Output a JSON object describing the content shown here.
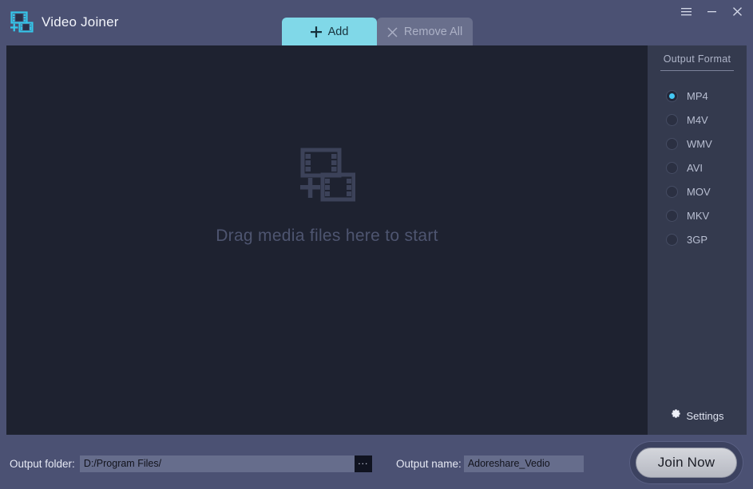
{
  "app": {
    "title": "Video Joiner",
    "logo_icon": "film-plus-icon"
  },
  "window_controls": {
    "menu_icon": "hamburger-menu-icon",
    "minimize_icon": "minimize-icon",
    "close_icon": "close-icon"
  },
  "tabs": [
    {
      "id": "add",
      "label": "Add",
      "icon": "plus-icon",
      "state": "active"
    },
    {
      "id": "remove-all",
      "label": "Remove All",
      "icon": "cross-icon",
      "state": "disabled"
    }
  ],
  "dropzone": {
    "icon": "film-plus-icon",
    "message": "Drag media files here to start"
  },
  "output_format": {
    "title": "Output Format",
    "selected": "MP4",
    "options": [
      {
        "label": "MP4",
        "selected": true
      },
      {
        "label": "M4V",
        "selected": false
      },
      {
        "label": "WMV",
        "selected": false
      },
      {
        "label": "AVI",
        "selected": false
      },
      {
        "label": "MOV",
        "selected": false
      },
      {
        "label": "MKV",
        "selected": false
      },
      {
        "label": "3GP",
        "selected": false
      }
    ],
    "settings": {
      "label": "Settings",
      "icon": "gear-icon"
    }
  },
  "bottom": {
    "output_folder": {
      "label": "Output folder:",
      "value": "D:/Program Files/",
      "placeholder": "D:/Program Files/",
      "browse_label": "...",
      "browse_icon": "ellipsis-icon"
    },
    "output_name": {
      "label": "Output name:",
      "value": "Adoreshare_Vedio",
      "placeholder": "Adoreshare_Vedio"
    },
    "join_button": "Join Now"
  },
  "colors": {
    "accent_cyan": "#80d8e8",
    "radio_dot": "#44c8f5",
    "frame": "#4b5173",
    "canvas": "#1e2230",
    "panel": "#343a4e",
    "logo": "#35c6ea"
  }
}
